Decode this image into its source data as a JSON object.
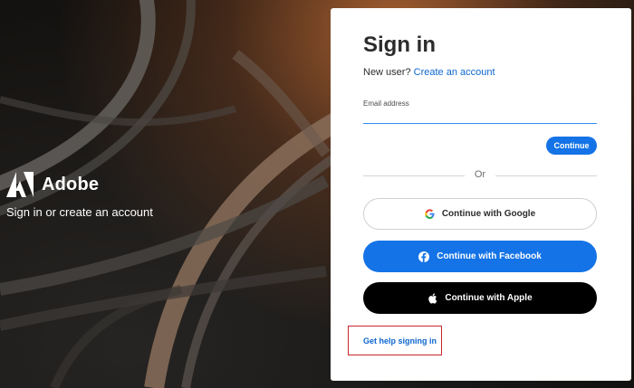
{
  "brand": {
    "name": "Adobe",
    "tagline": "Sign in or create an account"
  },
  "signin": {
    "title": "Sign in",
    "new_user_prefix": "New user?",
    "create_account_link": "Create an account",
    "email_label": "Email address",
    "email_value": "",
    "continue_label": "Continue",
    "divider_text": "Or",
    "google_label": "Continue with Google",
    "facebook_label": "Continue with Facebook",
    "apple_label": "Continue with Apple",
    "help_link": "Get help signing in"
  },
  "colors": {
    "accent": "#1473e6",
    "link": "#0d66d0",
    "highlight_border": "#c8282e",
    "apple_button": "#000000"
  },
  "icons": {
    "logo": "adobe-logo-icon",
    "google": "google-icon",
    "facebook": "facebook-icon",
    "apple": "apple-icon"
  }
}
